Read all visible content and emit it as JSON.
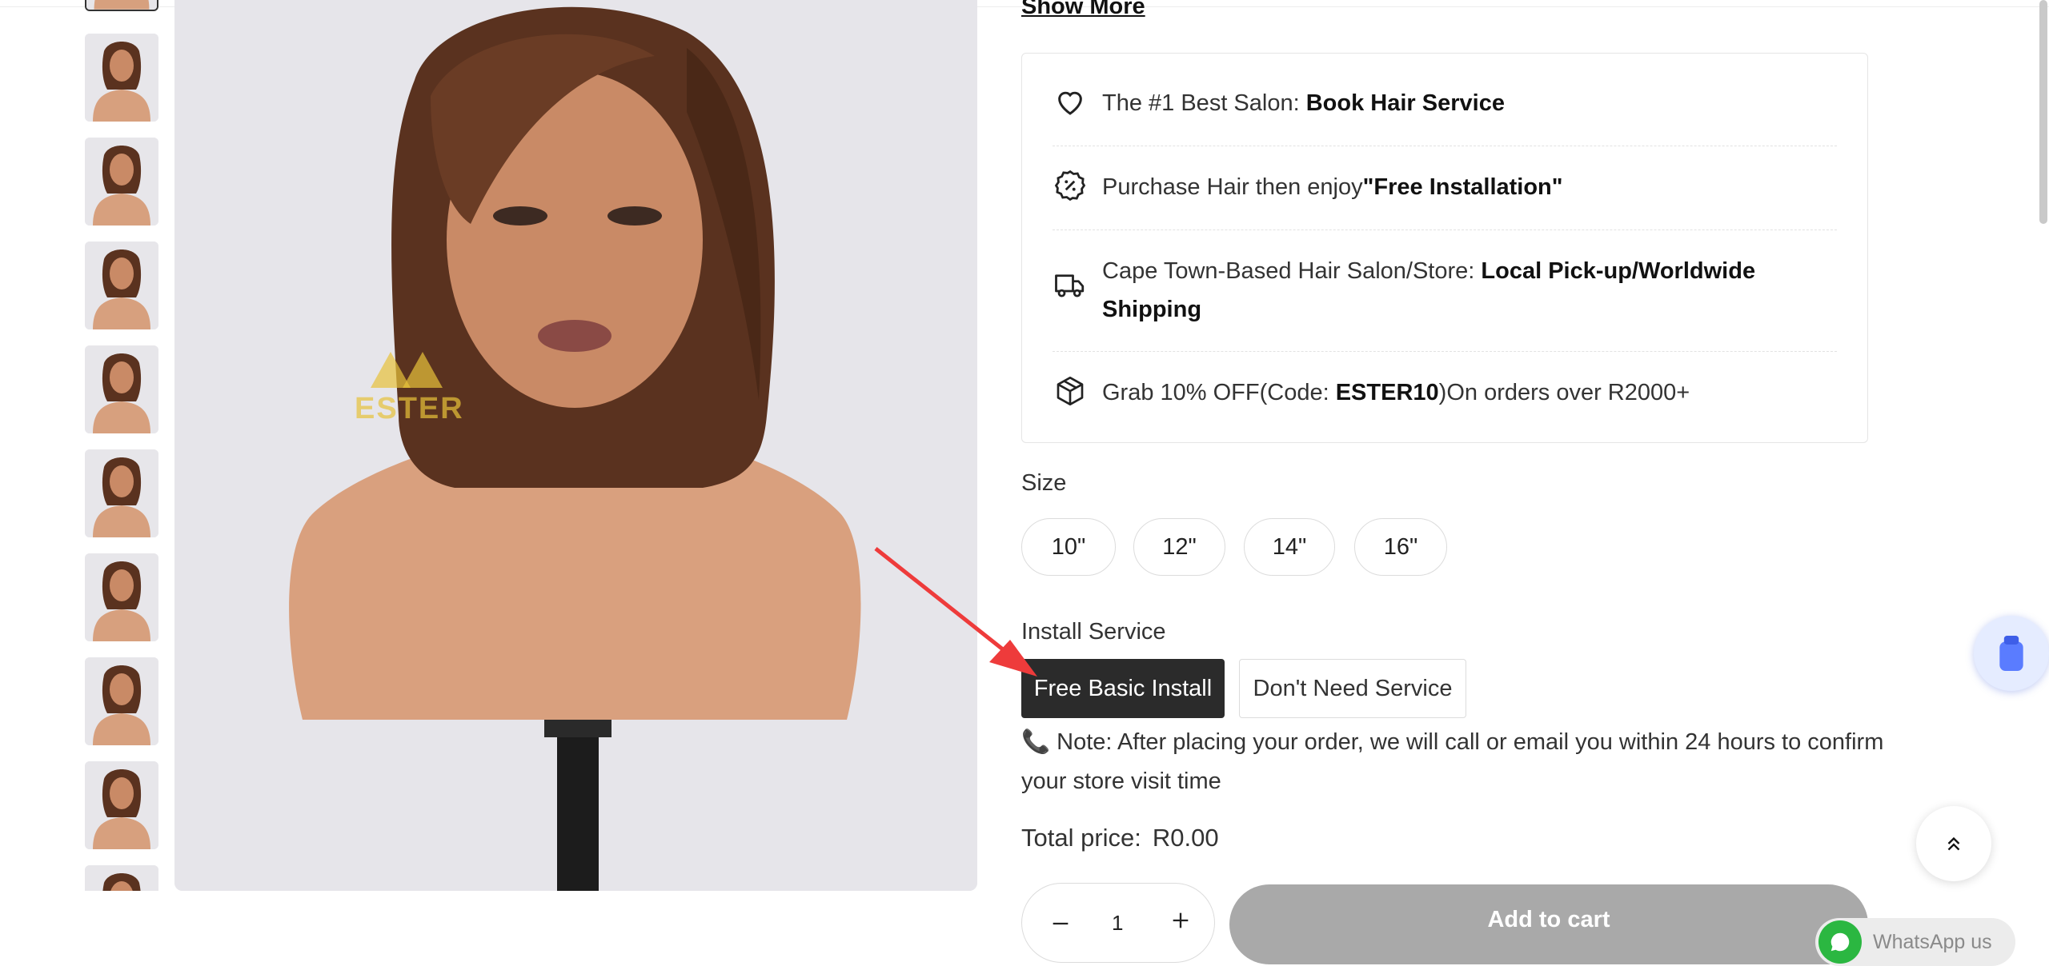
{
  "product": {
    "show_more": "Show More",
    "watermark": "ESTER",
    "promos": [
      {
        "icon": "heart-icon",
        "text": "The #1 Best Salon: ",
        "bold": "Book Hair Service",
        "tail": ""
      },
      {
        "icon": "discount-badge-icon",
        "text": "Purchase Hair then enjoy",
        "bold": "\"Free Installation\"",
        "tail": ""
      },
      {
        "icon": "delivery-truck-icon",
        "text": "Cape Town-Based Hair Salon/Store: ",
        "bold": "Local Pick-up/Worldwide Shipping",
        "tail": ""
      },
      {
        "icon": "package-icon",
        "text": "Grab 10% OFF(Code: ",
        "bold": "ESTER10",
        "tail": ")On orders over R2000+"
      }
    ],
    "size_label": "Size",
    "sizes": [
      "10\"",
      "12\"",
      "14\"",
      "16\""
    ],
    "install_label": "Install Service",
    "install_options": [
      "Free Basic Install",
      "Don't Need Service"
    ],
    "install_selected": "Free Basic Install",
    "note": "Note: After placing your order, we will call or email you within 24 hours to confirm your store visit time",
    "total_label": "Total price:",
    "total_value": "R0.00",
    "quantity": "1",
    "add_to_cart": "Add to cart"
  },
  "widgets": {
    "whatsapp_label": "WhatsApp us",
    "scroll_top_icon": "double-chevron-up-icon",
    "chat_icon": "chat-cup-icon"
  },
  "colors": {
    "selected_button": "#2b2b2b",
    "add_to_cart_bg": "#a9a9a9",
    "arrow": "#ee3b3b",
    "whatsapp_green": "#2bb741"
  }
}
